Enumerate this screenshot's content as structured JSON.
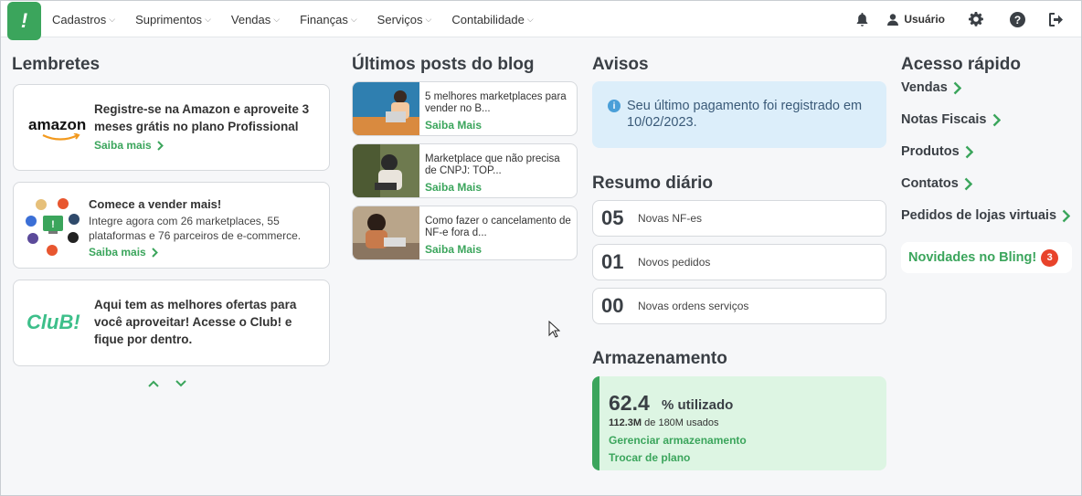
{
  "nav": {
    "menu": [
      "Cadastros",
      "Suprimentos",
      "Vendas",
      "Finanças",
      "Serviços",
      "Contabilidade"
    ],
    "user_label": "Usuário",
    "icons": [
      "bell-icon",
      "user-icon",
      "gear-icon",
      "help-icon",
      "logout-icon"
    ]
  },
  "reminders": {
    "title": "Lembretes",
    "amazon_logo": "amazon",
    "amazon_text": "Registre-se na Amazon e aproveite 3 meses grátis no plano Profissional",
    "amazon_link": "Saiba mais",
    "sell_title": "Comece a vender mais!",
    "sell_text": "Integre agora com 26 marketplaces, 55 plataformas e 76 parceiros de e-commerce.",
    "sell_link": "Saiba mais",
    "club_logo": "CluB!",
    "club_text": "Aqui tem as melhores ofertas para você aproveitar! Acesse o Club! e fique por dentro."
  },
  "blog": {
    "title": "Últimos posts do blog",
    "posts": [
      {
        "title": "5 melhores marketplaces para vender no B...",
        "link": "Saiba Mais"
      },
      {
        "title": "Marketplace que não precisa de CNPJ: TOP...",
        "link": "Saiba Mais"
      },
      {
        "title": "Como fazer o cancelamento de NF-e fora d...",
        "link": "Saiba Mais"
      }
    ]
  },
  "avisos": {
    "title": "Avisos",
    "message": "Seu último pagamento foi registrado em 10/02/2023."
  },
  "resumo": {
    "title": "Resumo diário",
    "items": [
      {
        "num": "05",
        "label": "Novas NF-es"
      },
      {
        "num": "01",
        "label": "Novos pedidos"
      },
      {
        "num": "00",
        "label": "Novas ordens serviços"
      }
    ]
  },
  "storage": {
    "title": "Armazenamento",
    "percent": "62.4",
    "percent_label": "% utilizado",
    "used": "112.3M",
    "used_label": "de 180M usados",
    "manage": "Gerenciar armazenamento",
    "change_plan": "Trocar de plano"
  },
  "quick": {
    "title": "Acesso rápido",
    "items": [
      "Vendas",
      "Notas Fiscais",
      "Produtos",
      "Contatos",
      "Pedidos de lojas virtuais"
    ],
    "news": "Novidades no Bling!",
    "news_count": "3"
  },
  "colors": {
    "brand": "#3ba55c",
    "info_bg": "#dceefa",
    "storage_bg": "#ddf5e3",
    "badge": "#e8432b"
  }
}
